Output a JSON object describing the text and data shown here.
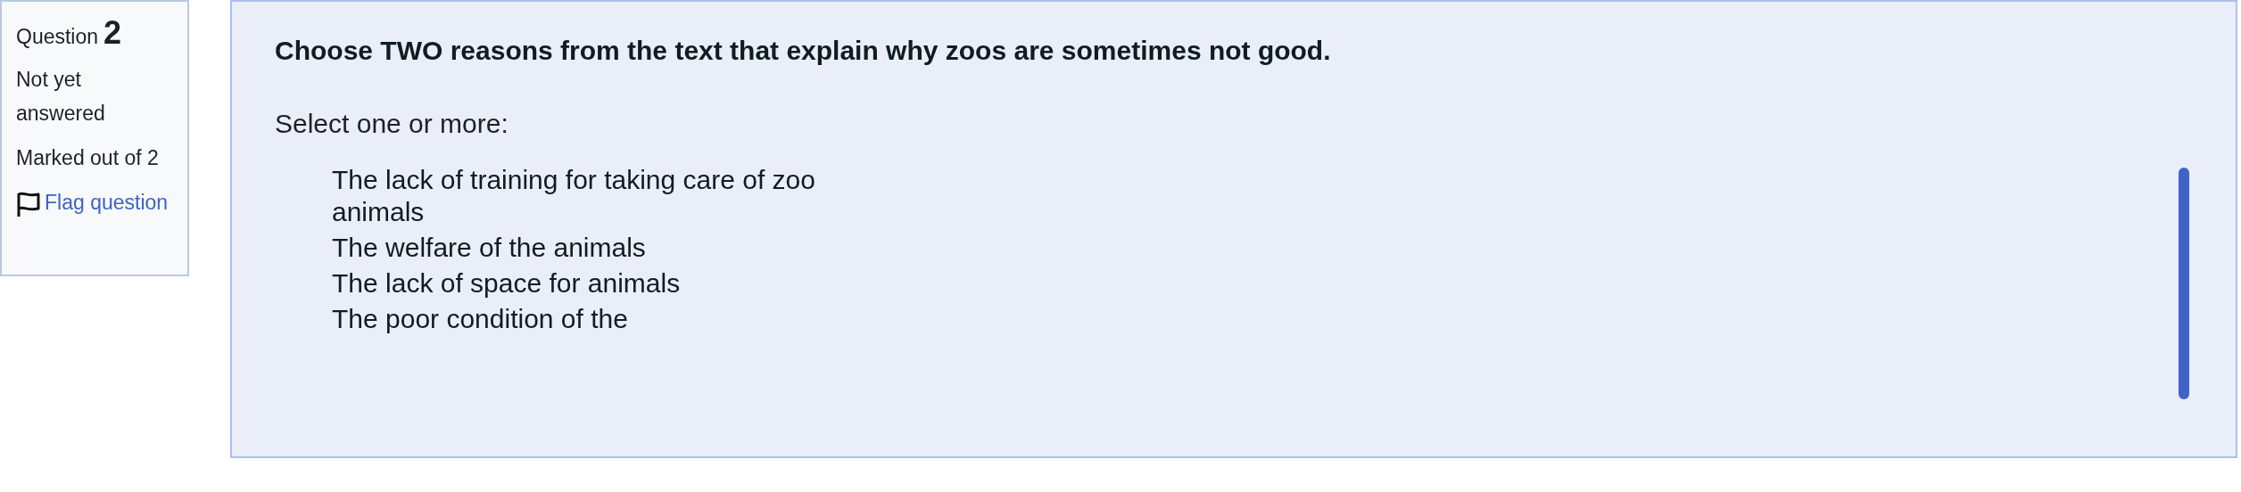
{
  "info": {
    "label": "Question",
    "number": "2",
    "status": "Not yet answered",
    "marks": "Marked out of 2",
    "flag_link": "Flag question",
    "flagged": false
  },
  "question": {
    "prompt": "Choose TWO reasons from the text that explain why zoos are sometimes not good.",
    "instruction": "Select one or more:",
    "options": [
      {
        "label": "The lack of training for taking care of zoo animals"
      },
      {
        "label": "The welfare of the animals"
      },
      {
        "label": "The lack of space for animals"
      },
      {
        "label": "The poor condition of the"
      }
    ]
  }
}
